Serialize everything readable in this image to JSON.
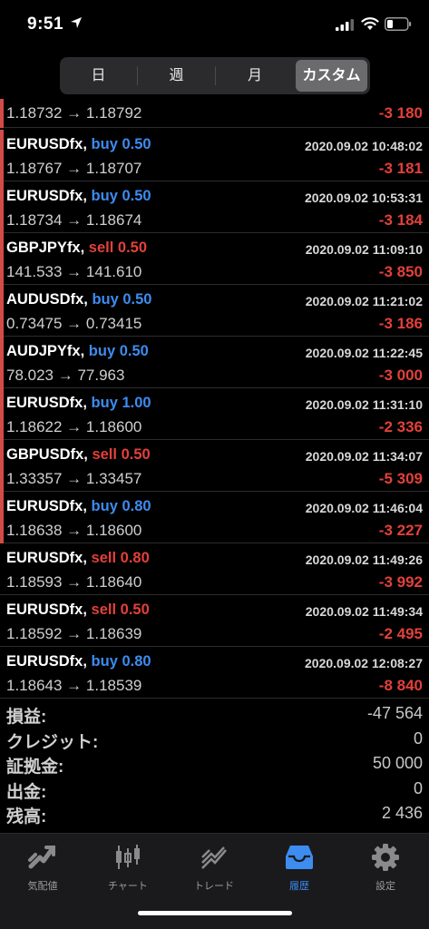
{
  "status": {
    "time": "9:51"
  },
  "segments": [
    {
      "label": "日",
      "active": false
    },
    {
      "label": "週",
      "active": false
    },
    {
      "label": "月",
      "active": false
    },
    {
      "label": "カスタム",
      "active": true
    }
  ],
  "colors": {
    "buy": "#3d8cf0",
    "sell": "#e2413a",
    "loss": "#e2413a",
    "accent": "#3d8cf0"
  },
  "trades": [
    {
      "symbol": "",
      "side": "",
      "volume": "",
      "date": "",
      "open": "1.18732",
      "close": "1.18792",
      "pnl": "-3 180",
      "marked": true
    },
    {
      "symbol": "EURUSDfx,",
      "side": "buy",
      "volume": "0.50",
      "date": "2020.09.02 10:48:02",
      "open": "1.18767",
      "close": "1.18707",
      "pnl": "-3 181",
      "marked": true
    },
    {
      "symbol": "EURUSDfx,",
      "side": "buy",
      "volume": "0.50",
      "date": "2020.09.02 10:53:31",
      "open": "1.18734",
      "close": "1.18674",
      "pnl": "-3 184",
      "marked": true
    },
    {
      "symbol": "GBPJPYfx,",
      "side": "sell",
      "volume": "0.50",
      "date": "2020.09.02 11:09:10",
      "open": "141.533",
      "close": "141.610",
      "pnl": "-3 850",
      "marked": true
    },
    {
      "symbol": "AUDUSDfx,",
      "side": "buy",
      "volume": "0.50",
      "date": "2020.09.02 11:21:02",
      "open": "0.73475",
      "close": "0.73415",
      "pnl": "-3 186",
      "marked": true
    },
    {
      "symbol": "AUDJPYfx,",
      "side": "buy",
      "volume": "0.50",
      "date": "2020.09.02 11:22:45",
      "open": "78.023",
      "close": "77.963",
      "pnl": "-3 000",
      "marked": true
    },
    {
      "symbol": "EURUSDfx,",
      "side": "buy",
      "volume": "1.00",
      "date": "2020.09.02 11:31:10",
      "open": "1.18622",
      "close": "1.18600",
      "pnl": "-2 336",
      "marked": true
    },
    {
      "symbol": "GBPUSDfx,",
      "side": "sell",
      "volume": "0.50",
      "date": "2020.09.02 11:34:07",
      "open": "1.33357",
      "close": "1.33457",
      "pnl": "-5 309",
      "marked": true
    },
    {
      "symbol": "EURUSDfx,",
      "side": "buy",
      "volume": "0.80",
      "date": "2020.09.02 11:46:04",
      "open": "1.18638",
      "close": "1.18600",
      "pnl": "-3 227",
      "marked": true
    },
    {
      "symbol": "EURUSDfx,",
      "side": "sell",
      "volume": "0.80",
      "date": "2020.09.02 11:49:26",
      "open": "1.18593",
      "close": "1.18640",
      "pnl": "-3 992",
      "marked": false
    },
    {
      "symbol": "EURUSDfx,",
      "side": "sell",
      "volume": "0.50",
      "date": "2020.09.02 11:49:34",
      "open": "1.18592",
      "close": "1.18639",
      "pnl": "-2 495",
      "marked": false
    },
    {
      "symbol": "EURUSDfx,",
      "side": "buy",
      "volume": "0.80",
      "date": "2020.09.02 12:08:27",
      "open": "1.18643",
      "close": "1.18539",
      "pnl": "-8 840",
      "marked": false
    }
  ],
  "summary": [
    {
      "label": "損益:",
      "value": "-47 564"
    },
    {
      "label": "クレジット:",
      "value": "0"
    },
    {
      "label": "証拠金:",
      "value": "50 000"
    },
    {
      "label": "出金:",
      "value": "0"
    },
    {
      "label": "残高:",
      "value": "2 436"
    }
  ],
  "tabs": [
    {
      "label": "気配値",
      "icon": "quotes-icon",
      "active": false
    },
    {
      "label": "チャート",
      "icon": "chart-candles-icon",
      "active": false
    },
    {
      "label": "トレード",
      "icon": "trade-icon",
      "active": false
    },
    {
      "label": "履歴",
      "icon": "history-inbox-icon",
      "active": true
    },
    {
      "label": "設定",
      "icon": "gear-icon",
      "active": false
    }
  ]
}
